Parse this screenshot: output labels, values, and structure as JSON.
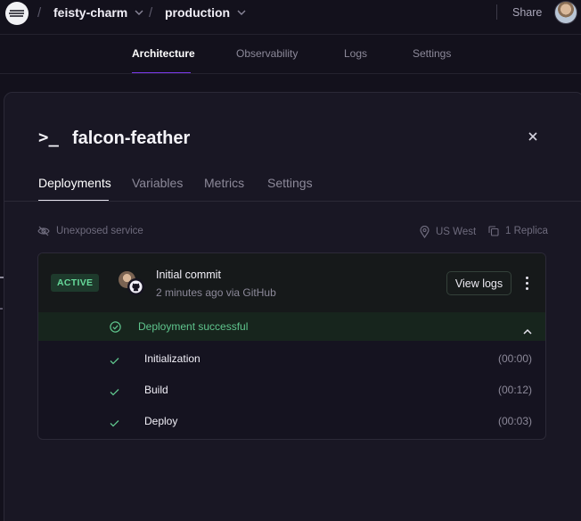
{
  "topbar": {
    "project": "feisty-charm",
    "environment": "production",
    "share_label": "Share"
  },
  "main_nav": {
    "tabs": [
      {
        "label": "Architecture",
        "active": true
      },
      {
        "label": "Observability",
        "active": false
      },
      {
        "label": "Logs",
        "active": false
      },
      {
        "label": "Settings",
        "active": false
      }
    ]
  },
  "service": {
    "name": "falcon-feather",
    "icon": "terminal-prompt-icon",
    "tabs": [
      {
        "label": "Deployments",
        "active": true
      },
      {
        "label": "Variables",
        "active": false
      },
      {
        "label": "Metrics",
        "active": false
      },
      {
        "label": "Settings",
        "active": false
      }
    ],
    "exposure": "Unexposed service",
    "region": "US West",
    "replicas": "1 Replica"
  },
  "deployment": {
    "status_badge": "ACTIVE",
    "commit_message": "Initial commit",
    "meta": "2 minutes ago via GitHub",
    "view_logs_label": "View logs",
    "result": "Deployment successful",
    "steps": [
      {
        "name": "Initialization",
        "duration": "(00:00)"
      },
      {
        "name": "Build",
        "duration": "(00:12)"
      },
      {
        "name": "Deploy",
        "duration": "(00:03)"
      }
    ]
  },
  "colors": {
    "accent": "#7c3aed",
    "success": "#5fc58d",
    "background": "#13111c",
    "panel": "#191724"
  }
}
